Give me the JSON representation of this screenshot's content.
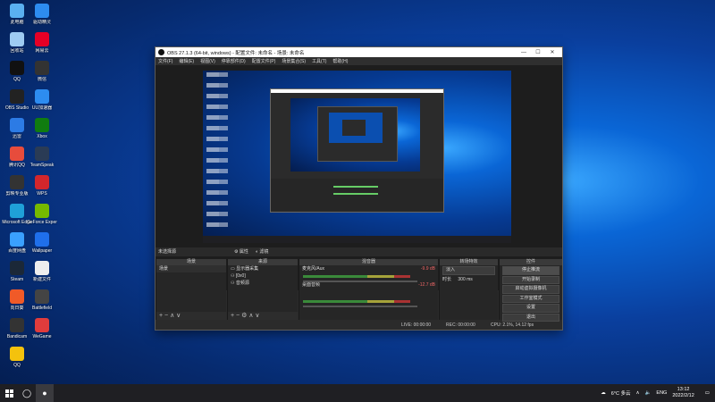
{
  "desktop": {
    "icons": [
      {
        "label": "此电脑",
        "color": "#5ab0f0",
        "col": 0,
        "row": 0
      },
      {
        "label": "回收站",
        "color": "#9ecbf2",
        "col": 0,
        "row": 1
      },
      {
        "label": "QQ",
        "color": "#111",
        "col": 0,
        "row": 2
      },
      {
        "label": "OBS Studio",
        "color": "#222",
        "col": 0,
        "row": 3
      },
      {
        "label": "迅雷",
        "color": "#2c7be5",
        "col": 0,
        "row": 4
      },
      {
        "label": "腾讯QQ",
        "color": "#e74c3c",
        "col": 0,
        "row": 5
      },
      {
        "label": "剪映专业版",
        "color": "#333",
        "col": 0,
        "row": 6
      },
      {
        "label": "Microsoft Edge",
        "color": "#1fa0d8",
        "col": 0,
        "row": 7
      },
      {
        "label": "百度网盘",
        "color": "#3aa0ff",
        "col": 0,
        "row": 8
      },
      {
        "label": "Steam",
        "color": "#1b2838",
        "col": 0,
        "row": 9
      },
      {
        "label": "向日葵",
        "color": "#f05a28",
        "col": 0,
        "row": 10
      },
      {
        "label": "Bandicam",
        "color": "#333",
        "col": 0,
        "row": 11
      },
      {
        "label": "QQ",
        "color": "#f4c20d",
        "col": 0,
        "row": 12
      },
      {
        "label": "驱动精灵",
        "color": "#2d8cf0",
        "col": 1,
        "row": 0
      },
      {
        "label": "网易云",
        "color": "#e60026",
        "col": 1,
        "row": 1
      },
      {
        "label": "微信",
        "color": "#333",
        "col": 1,
        "row": 2
      },
      {
        "label": "UU加速器",
        "color": "#2d8cf0",
        "col": 1,
        "row": 3
      },
      {
        "label": "Xbox",
        "color": "#107c10",
        "col": 1,
        "row": 4
      },
      {
        "label": "TeamSpeak",
        "color": "#2a3b55",
        "col": 1,
        "row": 5
      },
      {
        "label": "WPS",
        "color": "#d3262c",
        "col": 1,
        "row": 6
      },
      {
        "label": "GeForce Experience",
        "color": "#76b900",
        "col": 1,
        "row": 7
      },
      {
        "label": "Wallpaper",
        "color": "#1f6feb",
        "col": 1,
        "row": 8
      },
      {
        "label": "新建文件",
        "color": "#eee",
        "col": 1,
        "row": 9
      },
      {
        "label": "Battlefield",
        "color": "#444",
        "col": 1,
        "row": 10
      },
      {
        "label": "WeGame",
        "color": "#e03c3c",
        "col": 1,
        "row": 11
      }
    ]
  },
  "obs": {
    "title": "OBS 27.1.3 (64-bit, windows) - 配置文件: 未命名 - 场景: 未命名",
    "menu": [
      "文件(F)",
      "编辑(E)",
      "视图(V)",
      "停靠部件(D)",
      "配置文件(P)",
      "场景集合(S)",
      "工具(T)",
      "帮助(H)"
    ],
    "no_source": "未选择源",
    "prop_label": "属性",
    "filter_label": "滤镜",
    "docks": {
      "scenes": {
        "title": "场景",
        "items": [
          "场景"
        ]
      },
      "sources": {
        "title": "来源",
        "items": [
          "显示器采集",
          "[0x0]",
          "音频源"
        ]
      },
      "mixer": {
        "title": "混音器",
        "ch1_name": "麦克风/Aux",
        "ch1_db": "-9.9 dB",
        "ch2_name": "桌面音频",
        "ch2_db": "-12.7 dB"
      },
      "transitions": {
        "title": "转场特效",
        "type": "淡入",
        "duration_label": "时长",
        "duration": "300 ms"
      },
      "controls": {
        "title": "控件",
        "buttons": [
          "停止推流",
          "开始录制",
          "启动虚拟摄像机",
          "工作室模式",
          "设置",
          "退出"
        ]
      }
    },
    "status": {
      "live": "LIVE: 00:00:00",
      "rec": "REC: 00:00:00",
      "cpu": "CPU: 2.1%, 14.12 fps"
    }
  },
  "taskbar": {
    "weather": "6°C 多云",
    "lang": "ENG",
    "time": "13:12",
    "date": "2022/2/12"
  }
}
